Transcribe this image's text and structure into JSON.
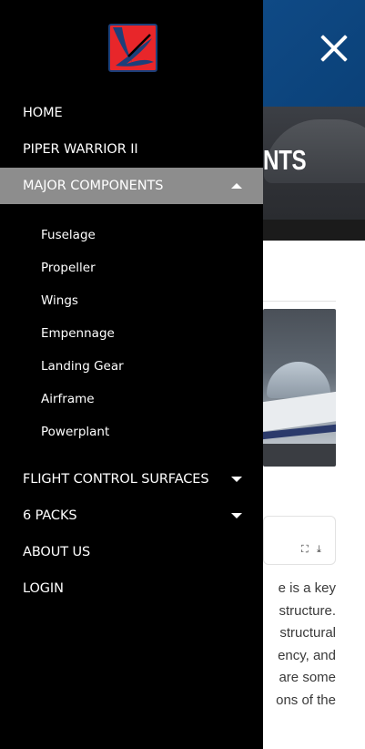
{
  "page": {
    "hero_title": "NTS",
    "body_lines": [
      "e is a key",
      "structure.",
      "structural",
      "ency, and",
      "are some",
      "ons of the"
    ]
  },
  "icons": {
    "close": "close-icon",
    "expand": "expand-icon",
    "download": "download-icon"
  },
  "drawer": {
    "items": [
      {
        "label": "HOME"
      },
      {
        "label": "PIPER WARRIOR II"
      },
      {
        "label": "MAJOR COMPONENTS",
        "expanded": true
      },
      {
        "label": "FLIGHT CONTROL SURFACES"
      },
      {
        "label": "6 PACKS"
      },
      {
        "label": "ABOUT US"
      },
      {
        "label": "LOGIN"
      }
    ],
    "sub_items": [
      "Fuselage",
      "Propeller",
      "Wings",
      "Empennage",
      "Landing Gear",
      "Airframe",
      "Powerplant"
    ]
  },
  "colors": {
    "drawer_bg": "#000000",
    "active_bg": "#8d8d8d",
    "header_blue": "#0f4a86",
    "logo_red": "#e8262a",
    "logo_blue": "#1d3f7a"
  }
}
